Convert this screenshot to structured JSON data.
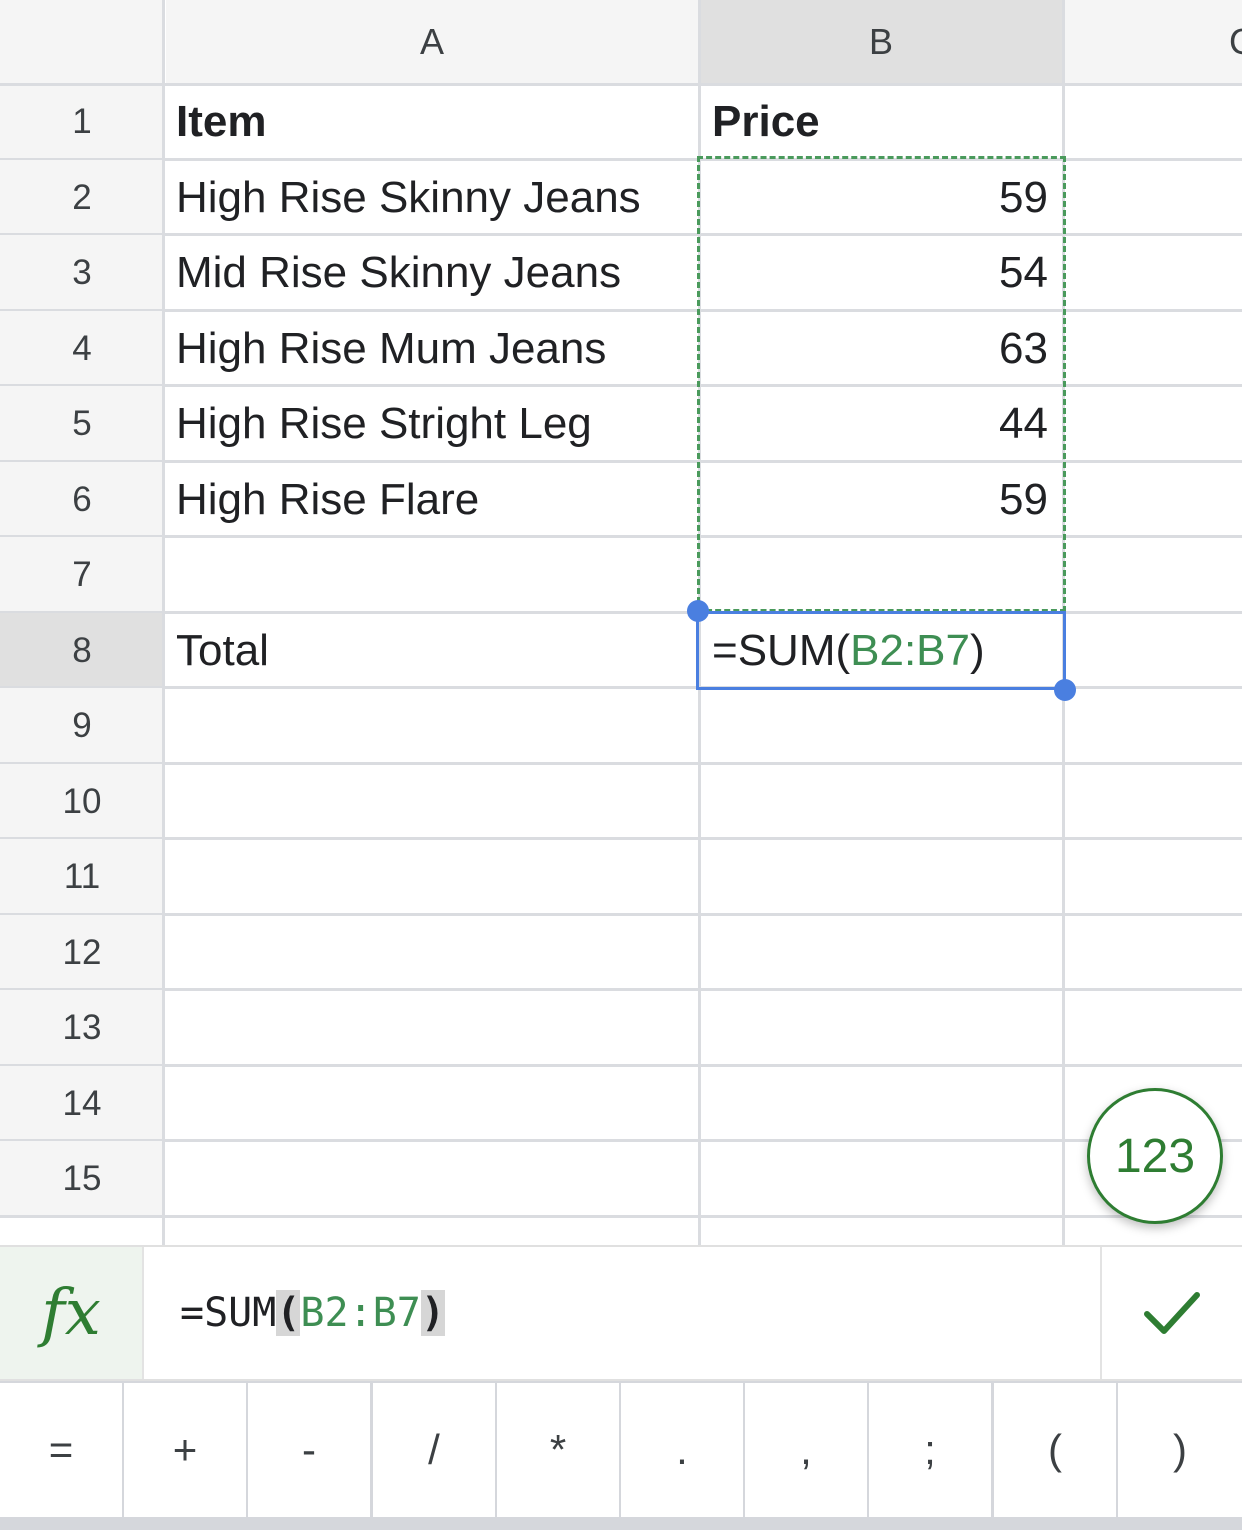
{
  "columns": [
    "A",
    "B",
    "C"
  ],
  "rows": [
    {
      "num": "1",
      "a": "Item",
      "b": "Price"
    },
    {
      "num": "2",
      "a": "High Rise Skinny Jeans",
      "b": "59"
    },
    {
      "num": "3",
      "a": "Mid Rise Skinny Jeans",
      "b": "54"
    },
    {
      "num": "4",
      "a": "High Rise Mum Jeans",
      "b": "63"
    },
    {
      "num": "5",
      "a": "High Rise Stright Leg",
      "b": "44"
    },
    {
      "num": "6",
      "a": "High Rise Flare",
      "b": "59"
    },
    {
      "num": "7",
      "a": "",
      "b": ""
    },
    {
      "num": "8",
      "a": "Total",
      "b": ""
    },
    {
      "num": "9",
      "a": "",
      "b": ""
    },
    {
      "num": "10",
      "a": "",
      "b": ""
    },
    {
      "num": "11",
      "a": "",
      "b": ""
    },
    {
      "num": "12",
      "a": "",
      "b": ""
    },
    {
      "num": "13",
      "a": "",
      "b": ""
    },
    {
      "num": "14",
      "a": "",
      "b": ""
    },
    {
      "num": "15",
      "a": "",
      "b": ""
    }
  ],
  "active_cell": {
    "formula_prefix": "=SUM(",
    "formula_range": "B2:B7",
    "formula_suffix": ")"
  },
  "formula_bar": {
    "fx_label": "fx",
    "prefix": "=SUM",
    "open_paren": "(",
    "range": "B2:B7",
    "close_paren": ")"
  },
  "fab_label": "123",
  "keyboard_keys": [
    "=",
    "+",
    "-",
    "/",
    "*",
    ".",
    ",",
    ";",
    "(",
    ")"
  ],
  "colors": {
    "range_green": "#3e8e53",
    "selection_blue": "#4a7fe0",
    "header_bg": "#f5f5f5",
    "selected_header_bg": "#e0e0e0"
  },
  "icons": [
    "check-icon"
  ]
}
